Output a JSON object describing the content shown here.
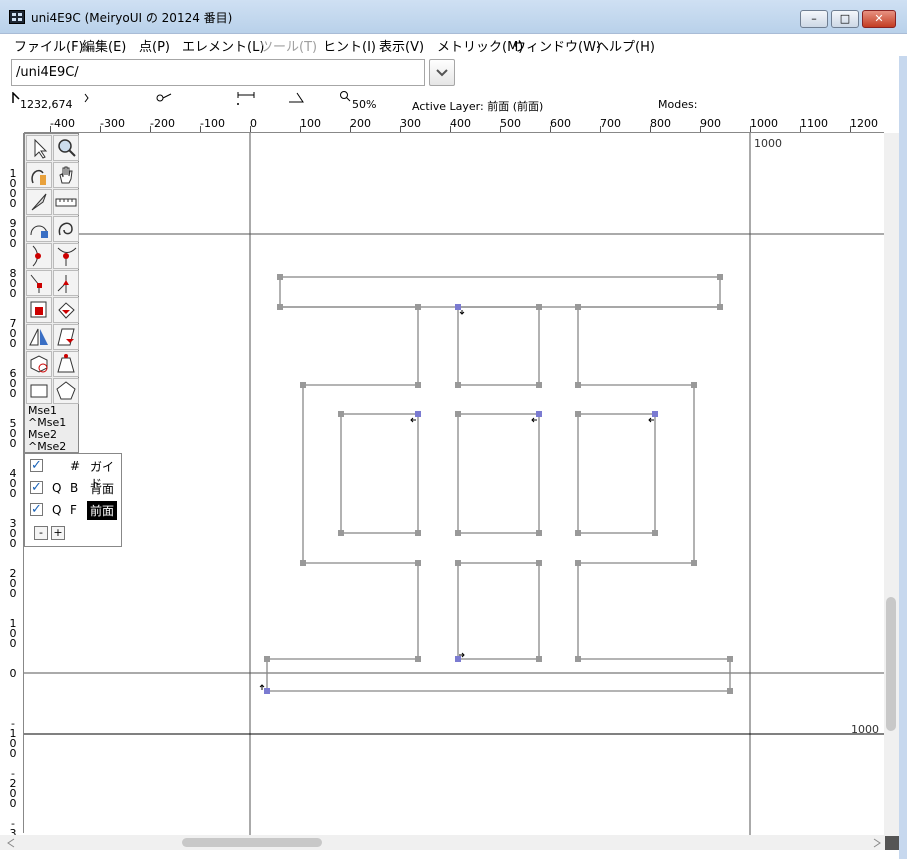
{
  "window": {
    "title": "uni4E9C (MeiryoUI の 20124 番目)",
    "buttons": {
      "minimize": "–",
      "maximize": "□",
      "close": "✕"
    }
  },
  "menu": [
    {
      "label": "ファイル(F)",
      "disabled": false
    },
    {
      "label": "編集(E)",
      "disabled": false
    },
    {
      "label": "点(P)",
      "disabled": false
    },
    {
      "label": "エレメント(L)",
      "disabled": false
    },
    {
      "label": "ツール(T)",
      "disabled": true
    },
    {
      "label": "ヒント(I)",
      "disabled": false
    },
    {
      "label": "表示(V)",
      "disabled": false
    },
    {
      "label": "メトリック(M)",
      "disabled": false
    },
    {
      "label": "ウィンドウ(W)",
      "disabled": false
    },
    {
      "label": "ヘルプ(H)",
      "disabled": false
    }
  ],
  "path_field": {
    "value": "/uni4E9C/"
  },
  "info": {
    "coords": "1232,674",
    "zoom": "50%",
    "active_layer": "Active Layer: 前面 (前面)",
    "modes": "Modes:"
  },
  "ruler_h": [
    "-400",
    "-300",
    "-200",
    "-100",
    "0",
    "100",
    "200",
    "300",
    "400",
    "500",
    "600",
    "700",
    "800",
    "900",
    "1000",
    "1100",
    "1200"
  ],
  "ruler_v": [
    "1\n0\n0\n0",
    "9\n0\n0",
    "8\n0\n0",
    "7\n0\n0",
    "6\n0\n0",
    "5\n0\n0",
    "4\n0\n0",
    "3\n0\n0",
    "2\n0\n0",
    "1\n0\n0",
    "0",
    "-\n1\n0\n0",
    "-\n2\n0\n0",
    "-\n3"
  ],
  "canvas_labels": {
    "width_top": "1000",
    "width_bottom": "1000"
  },
  "tools": {
    "mse1": "Mse1",
    "mse1_mod": "^Mse1",
    "mse2": "Mse2",
    "mse2_mod": "^Mse2"
  },
  "layers": [
    {
      "q": "",
      "b": "#",
      "name": "ガイド",
      "active": false
    },
    {
      "q": "Q",
      "b": "B",
      "name": "背面",
      "active": false
    },
    {
      "q": "Q",
      "b": "F",
      "name": "前面",
      "active": true
    }
  ],
  "layer_buttons": {
    "remove": "-",
    "add": "+"
  },
  "colors": {
    "titlebar": "#b9d1ea",
    "point": "#7b7bd1",
    "outline": "#888888"
  }
}
